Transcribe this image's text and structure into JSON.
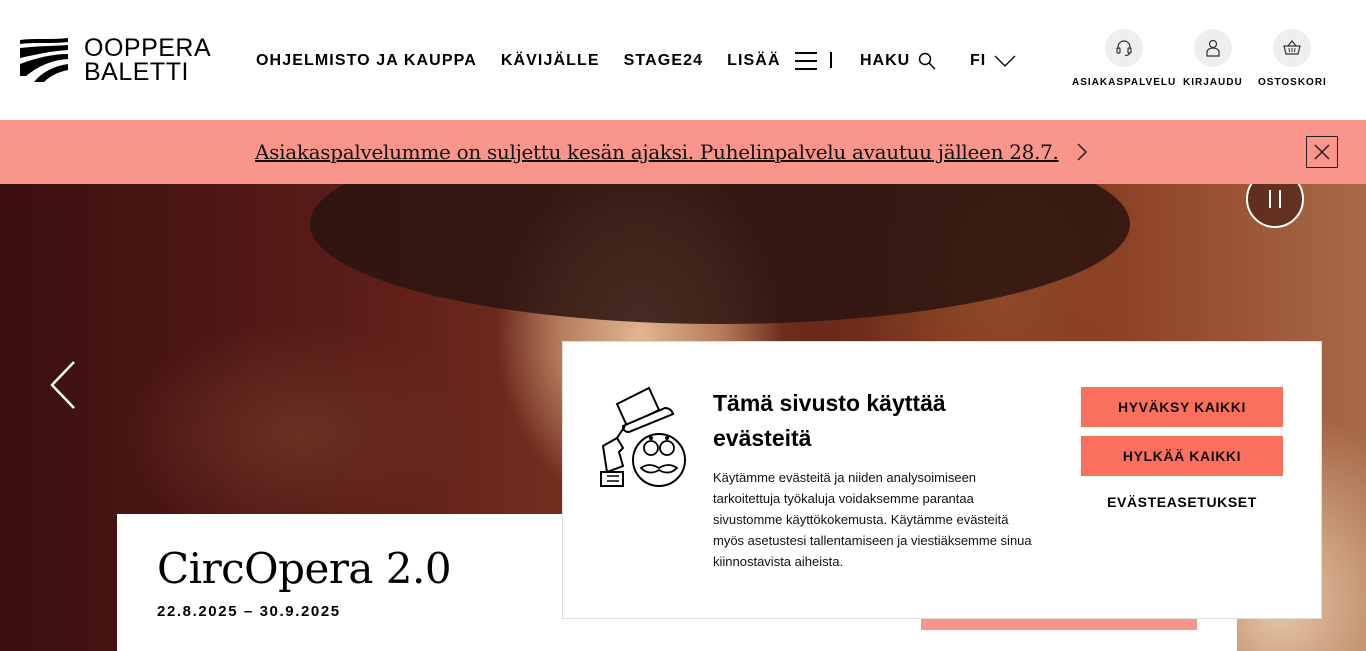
{
  "brand": {
    "line1": "OOPPERA",
    "line2": "BALETTI"
  },
  "nav": {
    "items": [
      "OHJELMISTO JA KAUPPA",
      "KÄVIJÄLLE",
      "STAGE24"
    ],
    "more_label": "LISÄÄ",
    "search_label": "HAKU",
    "lang_label": "FI"
  },
  "utility": {
    "customer_service": "ASIAKASPALVELU",
    "login": "KIRJAUDU",
    "cart": "OSTOSKORI"
  },
  "alert": {
    "text": "Asiakaspalvelumme on suljettu kesän ajaksi. Puhelinpalvelu avautuu jälleen 28.7."
  },
  "hero": {
    "event_title": "CircOpera 2.0",
    "event_dates": "22.8.2025 – 30.9.2025"
  },
  "cookie": {
    "title": "Tämä sivusto käyttää evästeitä",
    "body": "Käytämme evästeitä ja niiden analysoimiseen tarkoitettuja työkaluja voidaksemme parantaa sivustomme käyttökokemusta. Käytämme evästeitä myös asetustesi tallentamiseen ja viestiäksemme sinua kiinnostavista aiheista.",
    "accept_all": "HYVÄKSY KAIKKI",
    "reject_all": "HYLKÄÄ KAIKKI",
    "settings": "EVÄSTEASETUKSET"
  },
  "colors": {
    "alert_bg": "#f9958a",
    "cookie_button": "#fb6f5f"
  },
  "icons": [
    "brand-logo-icon",
    "hamburger-icon",
    "search-icon",
    "chevron-down-icon",
    "headset-icon",
    "user-icon",
    "basket-icon",
    "chevron-right-icon",
    "close-icon",
    "pause-icon",
    "arrow-left-icon",
    "cookie-illustration-icon"
  ]
}
